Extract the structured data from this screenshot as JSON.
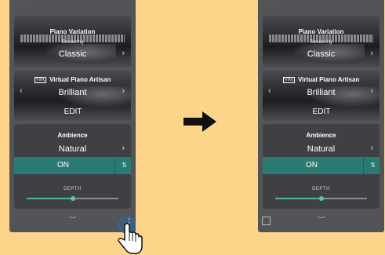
{
  "arrow": "right-arrow-icon",
  "screens": [
    {
      "id": "before",
      "status": "· · ·  ·",
      "piano_variation": {
        "title": "Piano Variation",
        "sub_label": "Rendering",
        "value": "Classic"
      },
      "vpa": {
        "logo": "VPA",
        "title": "Virtual Piano Artisan",
        "value": "Brilliant",
        "edit": "EDIT"
      },
      "ambience": {
        "title": "Ambience",
        "value": "Natural",
        "toggle": "ON",
        "depth_label": "DEPTH",
        "depth_level": 0.5
      },
      "corner_icon": "scroll-indicator-icon"
    },
    {
      "id": "after",
      "status": "· · ·  ·",
      "piano_variation": {
        "title": "Piano Variation",
        "sub_label": "Rendering",
        "value": "Classic"
      },
      "vpa": {
        "logo": "VPA",
        "title": "Virtual Piano Artisan",
        "value": "Brilliant",
        "edit": "EDIT"
      },
      "ambience": {
        "title": "Ambience",
        "value": "Natural",
        "toggle": "ON",
        "depth_label": "DEPTH",
        "depth_level": 0.5
      },
      "corner_icon": "small-square-icon"
    }
  ],
  "colors": {
    "background": "#fdd58a",
    "device": "#535458",
    "accent": "#2a7a74",
    "slider": "#4fb3a9"
  }
}
